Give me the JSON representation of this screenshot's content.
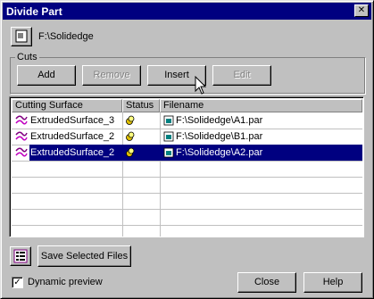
{
  "window": {
    "title": "Divide Part",
    "close_glyph": "✕"
  },
  "path": {
    "icon": "part-file-icon",
    "text": "F:\\Solidedge"
  },
  "cuts": {
    "group_label": "Cuts",
    "add_label": "Add",
    "remove_label": "Remove",
    "insert_label": "Insert",
    "edit_label": "Edit"
  },
  "table": {
    "columns": [
      "Cutting Surface",
      "Status",
      "Filename"
    ],
    "rows": [
      {
        "surface": "ExtrudedSurface_3",
        "file": "F:\\Solidedge\\A1.par",
        "selected": false
      },
      {
        "surface": "ExtrudedSurface_2",
        "file": "F:\\Solidedge\\B1.par",
        "selected": false
      },
      {
        "surface": "ExtrudedSurface_2",
        "file": "F:\\Solidedge\\A2.par",
        "selected": true
      }
    ]
  },
  "footer": {
    "list_icon": "list-options-icon",
    "save_label": "Save Selected Files",
    "dynamic_preview_label": "Dynamic preview",
    "dynamic_preview_checked": true,
    "check_glyph": "✓",
    "close_label": "Close",
    "help_label": "Help"
  },
  "colors": {
    "title_bar": "#000080",
    "face": "#c0c0c0",
    "selection": "#000080"
  }
}
